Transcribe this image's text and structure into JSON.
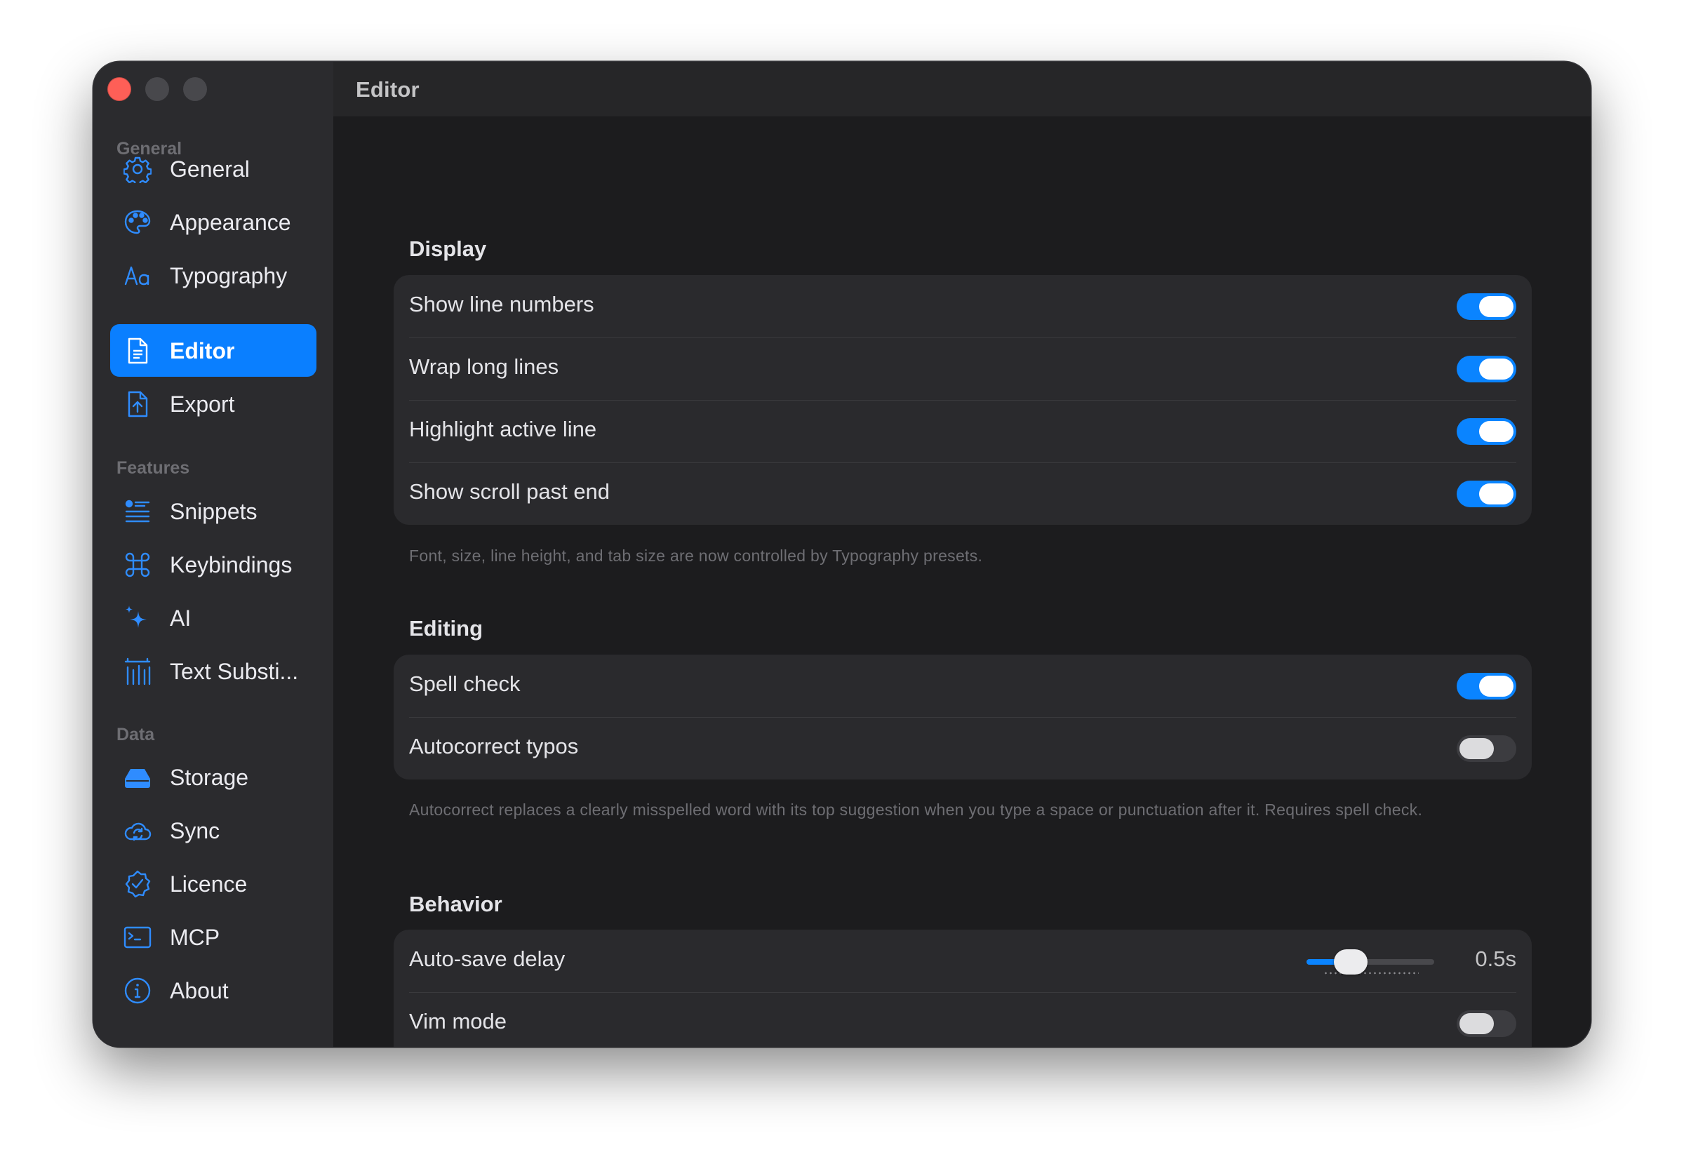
{
  "window": {
    "title": "Editor"
  },
  "sidebar": {
    "sections": [
      {
        "label": "General",
        "items": [
          {
            "label": "General",
            "icon": "gear-icon"
          },
          {
            "label": "Appearance",
            "icon": "palette-icon"
          },
          {
            "label": "Typography",
            "icon": "typography-icon"
          },
          {
            "label": "Editor",
            "icon": "document-icon",
            "active": true
          },
          {
            "label": "Export",
            "icon": "export-icon"
          }
        ]
      },
      {
        "label": "Features",
        "items": [
          {
            "label": "Snippets",
            "icon": "snippets-icon"
          },
          {
            "label": "Keybindings",
            "icon": "command-icon"
          },
          {
            "label": "AI",
            "icon": "sparkle-icon"
          },
          {
            "label": "Text Substi...",
            "icon": "text-substitution-icon"
          }
        ]
      },
      {
        "label": "Data",
        "items": [
          {
            "label": "Storage",
            "icon": "drive-icon"
          },
          {
            "label": "Sync",
            "icon": "cloud-sync-icon"
          },
          {
            "label": "Licence",
            "icon": "checkmark-seal-icon"
          },
          {
            "label": "MCP",
            "icon": "terminal-icon"
          },
          {
            "label": "About",
            "icon": "info-icon"
          }
        ]
      }
    ]
  },
  "display": {
    "title": "Display",
    "rows": [
      {
        "label": "Show line numbers",
        "on": true
      },
      {
        "label": "Wrap long lines",
        "on": true
      },
      {
        "label": "Highlight active line",
        "on": true
      },
      {
        "label": "Show scroll past end",
        "on": true
      }
    ],
    "note": "Font, size, line height, and tab size are now controlled by Typography presets."
  },
  "editing": {
    "title": "Editing",
    "rows": [
      {
        "label": "Spell check",
        "on": true
      },
      {
        "label": "Autocorrect typos",
        "on": false
      }
    ],
    "note": "Autocorrect replaces a clearly misspelled word with its top suggestion when you type a space or punctuation after it. Requires spell check."
  },
  "behavior": {
    "title": "Behavior",
    "autosave": {
      "label": "Auto-save delay",
      "value": "0.5s",
      "level": 0.29
    },
    "vim": {
      "label": "Vim mode",
      "on": false
    }
  },
  "colors": {
    "accent": "#0a84ff",
    "selected": "#0a7fff",
    "icon_blue": "#2f8cff",
    "close": "#fe5f57"
  }
}
